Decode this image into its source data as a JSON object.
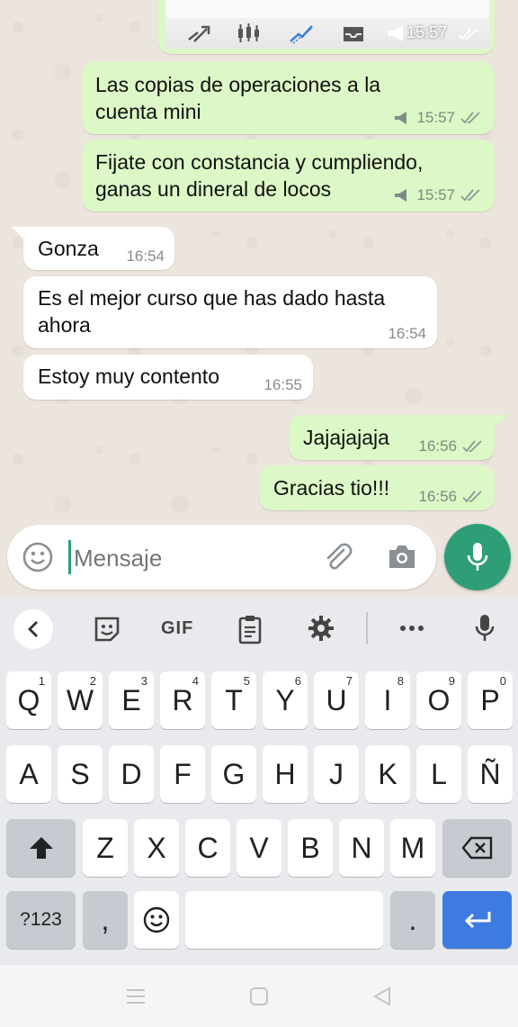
{
  "top_bubble": {
    "time": "15:57"
  },
  "messages": [
    {
      "dir": "out",
      "lines": [
        "Las copias de operaciones a la",
        "cuenta mini"
      ],
      "time": "15:57"
    },
    {
      "dir": "out",
      "lines": [
        "Fijate con constancia y cumpliendo,",
        "ganas un dineral de locos"
      ],
      "time": "15:57"
    },
    {
      "dir": "in",
      "lines": [
        "Gonza"
      ],
      "time": "16:54"
    },
    {
      "dir": "in",
      "lines": [
        "Es el mejor curso que has dado hasta",
        "ahora"
      ],
      "time": "16:54"
    },
    {
      "dir": "in",
      "lines": [
        "Estoy muy contento"
      ],
      "time": "16:55"
    },
    {
      "dir": "out",
      "lines": [
        "Jajajajaja"
      ],
      "time": "16:56"
    },
    {
      "dir": "out",
      "lines": [
        "Gracias tio!!!"
      ],
      "time": "16:56"
    }
  ],
  "input": {
    "placeholder": "Mensaje"
  },
  "keyboard": {
    "toolbar_gif": "GIF",
    "row1": [
      "Q",
      "W",
      "E",
      "R",
      "T",
      "Y",
      "U",
      "I",
      "O",
      "P"
    ],
    "row1_hints": [
      "1",
      "2",
      "3",
      "4",
      "5",
      "6",
      "7",
      "8",
      "9",
      "0"
    ],
    "row2": [
      "A",
      "S",
      "D",
      "F",
      "G",
      "H",
      "J",
      "K",
      "L",
      "Ñ"
    ],
    "row3": [
      "Z",
      "X",
      "C",
      "V",
      "B",
      "N",
      "M"
    ],
    "num_key": "?123",
    "comma_key": ",",
    "period_key": "."
  },
  "colors": {
    "outgoing": "#dcf8c6",
    "incoming": "#ffffff",
    "fab": "#2e9e77",
    "enter": "#3d7be0",
    "tick": "#8a9a90"
  }
}
